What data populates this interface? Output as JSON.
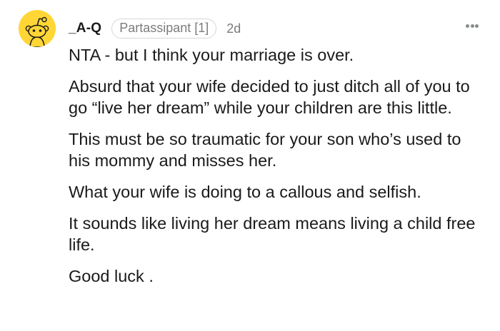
{
  "comment": {
    "avatar_icon": "reddit-snoo-avatar-icon",
    "avatar_color": "#ffd635",
    "username": "_A-Q",
    "flair": "Partassipant [1]",
    "timestamp": "2d",
    "more_icon": "more-options-icon",
    "paragraphs": [
      "NTA - but I think your marriage is over.",
      "Absurd that your wife decided to just ditch all of you to go “live her dream” while your children are this little.",
      "This must be so traumatic for your son who’s used to his mommy and misses her.",
      "What your wife is doing to a callous and selfish.",
      "It sounds like living her dream means living a child free life.",
      "Good luck ."
    ]
  }
}
